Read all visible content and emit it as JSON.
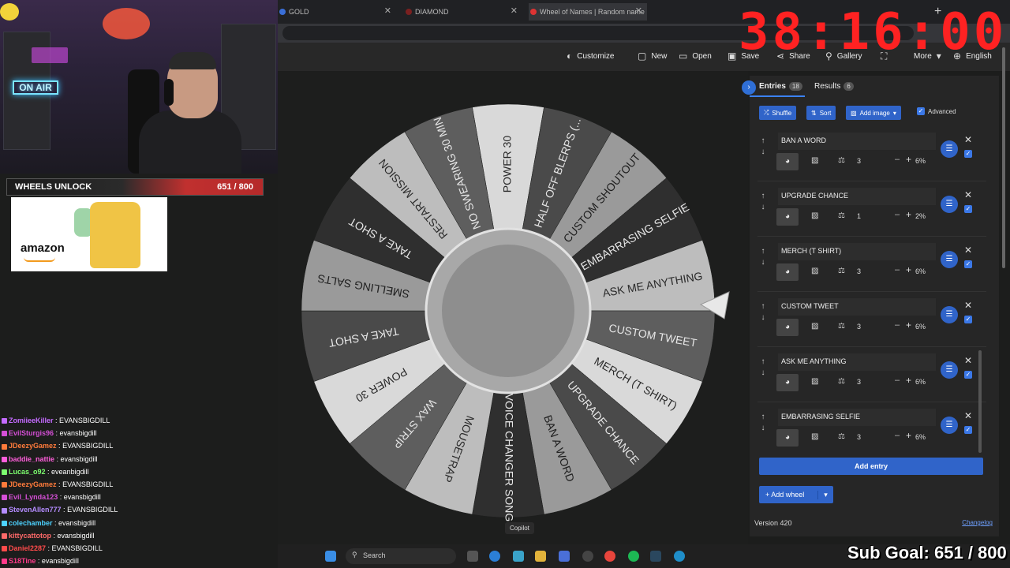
{
  "browser": {
    "tabs": [
      {
        "label": "GOLD"
      },
      {
        "label": "DIAMOND"
      },
      {
        "label": "Wheel of Names | Random name"
      }
    ]
  },
  "toolbar": {
    "customize": "Customize",
    "new": "New",
    "open": "Open",
    "save": "Save",
    "share": "Share",
    "gallery": "Gallery",
    "more": "More",
    "language": "English"
  },
  "timer": "38:16:00",
  "sidebar": {
    "entries_tab": "Entries",
    "entries_count": "18",
    "results_tab": "Results",
    "results_count": "6",
    "shuffle": "Shuffle",
    "sort": "Sort",
    "add_image": "Add image",
    "advanced": "Advanced",
    "entries": [
      {
        "name": "BAN A WORD",
        "weight": "3",
        "pct": "6%"
      },
      {
        "name": "UPGRADE CHANCE",
        "weight": "1",
        "pct": "2%"
      },
      {
        "name": "MERCH (T SHIRT)",
        "weight": "3",
        "pct": "6%"
      },
      {
        "name": "CUSTOM TWEET",
        "weight": "3",
        "pct": "6%"
      },
      {
        "name": "ASK ME ANYTHING",
        "weight": "3",
        "pct": "6%"
      },
      {
        "name": "EMBARRASING SELFIE",
        "weight": "3",
        "pct": "6%"
      }
    ],
    "add_entry": "Add entry",
    "add_wheel": "Add wheel",
    "version": "Version 420",
    "changelog": "Changelog"
  },
  "wheel": {
    "segments": [
      "POWER 30",
      "HALF OFF BLERPS (...",
      "CUSTOM SHOUTOUT",
      "EMBARRASING SELFIE",
      "ASK ME ANYTHING",
      "CUSTOM TWEET",
      "MERCH (T SHIRT)",
      "UPGRADE CHANCE",
      "BAN A WORD",
      "VOICE CHANGER SONG",
      "MOUSETRAP",
      "WAX STRIP",
      "POWER 30",
      "TAKE A SHOT",
      "SMELLING SALTS",
      "TAKE A SHOT",
      "RESTART MISSION",
      "NO SWEARING 30 MIN"
    ]
  },
  "copilot": "Copilot",
  "overlay": {
    "on_air": "ON AIR",
    "wheels_label": "WHEELS UNLOCK",
    "wheels_count": "651 / 800",
    "wheels_progress": 0.814,
    "amazon": "amazon",
    "sub_goal": "Sub Goal: 651 / 800"
  },
  "chat": [
    {
      "user": "ZomiieeKiller",
      "msg": "EVANSBIGDILL",
      "color": "#c46bff"
    },
    {
      "user": "EvilSturgis96",
      "msg": "evansbigdill",
      "color": "#d54fd6"
    },
    {
      "user": "JDeezyGamez",
      "msg": "EVANSBIGDILL",
      "color": "#ff7b3b"
    },
    {
      "user": "baddie_nattie",
      "msg": "evansbigdill",
      "color": "#ff5edb"
    },
    {
      "user": "Lucas_o92",
      "msg": "eveanbigdill",
      "color": "#7dff6f"
    },
    {
      "user": "JDeezyGamez",
      "msg": "EVANSBIGDILL",
      "color": "#ff7b3b"
    },
    {
      "user": "Evil_Lynda123",
      "msg": "evansbigdill",
      "color": "#d54fd6"
    },
    {
      "user": "StevenAllen777",
      "msg": "EVANSBIGDILL",
      "color": "#b48cff"
    },
    {
      "user": "colechamber",
      "msg": "evansbigdill",
      "color": "#4dd2ff"
    },
    {
      "user": "kittycattotop",
      "msg": "evansbigdill",
      "color": "#ff6a6a"
    },
    {
      "user": "Daniel2287",
      "msg": "EVANSBIGDILL",
      "color": "#ff4b4b"
    },
    {
      "user": "S18Tine",
      "msg": "evansbigdill",
      "color": "#ff3b8a"
    }
  ],
  "taskbar": {
    "search": "Search"
  }
}
